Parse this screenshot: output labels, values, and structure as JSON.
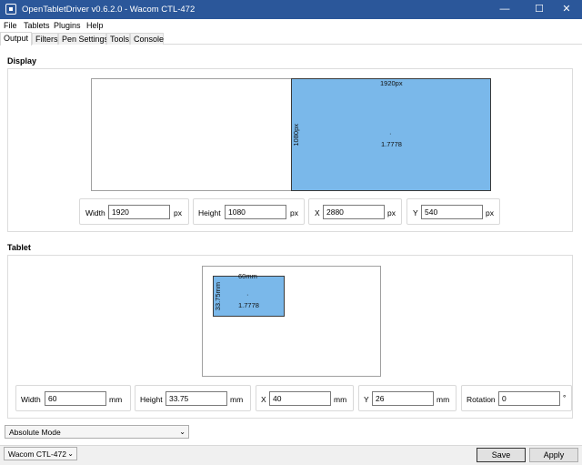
{
  "window": {
    "title": "OpenTabletDriver v0.6.2.0 - Wacom CTL-472",
    "minimize": "—",
    "maximize": "☐",
    "close": "✕"
  },
  "menu": [
    "File",
    "Tablets",
    "Plugins",
    "Help"
  ],
  "tabs": [
    "Output",
    "Filters",
    "Pen Settings",
    "Tools",
    "Console"
  ],
  "display": {
    "section_title": "Display",
    "area_width_label": "1920px",
    "area_height_label": "1080px",
    "aspect_ratio": "1.7778",
    "center_dot": "·",
    "fields": {
      "width_label": "Width",
      "width_value": "1920",
      "width_unit": "px",
      "height_label": "Height",
      "height_value": "1080",
      "height_unit": "px",
      "x_label": "X",
      "x_value": "2880",
      "x_unit": "px",
      "y_label": "Y",
      "y_value": "540",
      "y_unit": "px"
    }
  },
  "tablet": {
    "section_title": "Tablet",
    "area_width_label": "60mm",
    "area_height_label": "33.75mm",
    "aspect_ratio": "1.7778",
    "center_dot": "·",
    "fields": {
      "width_label": "Width",
      "width_value": "60",
      "width_unit": "mm",
      "height_label": "Height",
      "height_value": "33.75",
      "height_unit": "mm",
      "x_label": "X",
      "x_value": "40",
      "x_unit": "mm",
      "y_label": "Y",
      "y_value": "26",
      "y_unit": "mm",
      "rotation_label": "Rotation",
      "rotation_value": "0",
      "rotation_unit": "°"
    }
  },
  "output_mode": {
    "selected": "Absolute Mode"
  },
  "statusbar": {
    "tablet_selector": "Wacom CTL-472",
    "save_label": "Save",
    "apply_label": "Apply"
  },
  "colors": {
    "titlebar": "#2b579a",
    "area_fill": "#7ab8ea"
  }
}
